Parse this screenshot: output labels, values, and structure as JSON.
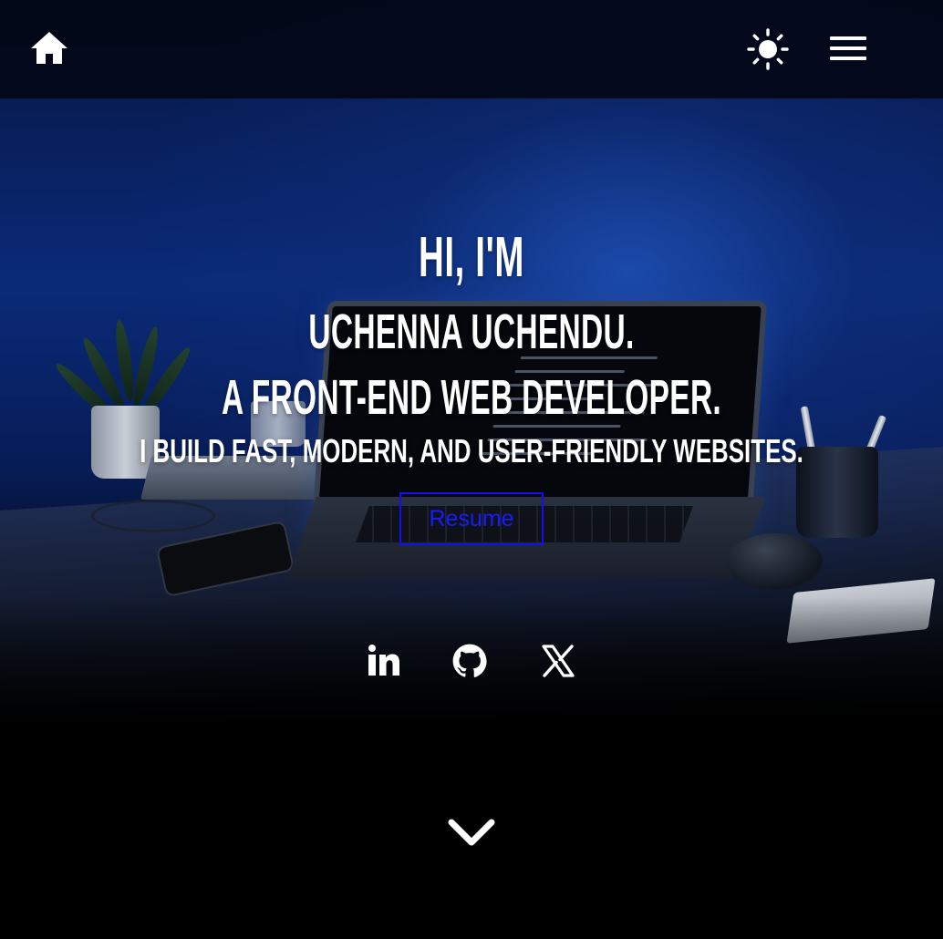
{
  "header": {
    "home_icon": "home-icon",
    "theme_icon": "sun-icon",
    "menu_icon": "hamburger-menu-icon"
  },
  "hero": {
    "greeting": "Hi, I'm",
    "name": "Uchenna Uchendu.",
    "role": "A Front-end Web developer.",
    "tagline": "I build fast, modern, and user-friendly websites.",
    "resume_label": "Resume"
  },
  "social": {
    "items": [
      {
        "icon": "linkedin-icon",
        "label": "LinkedIn"
      },
      {
        "icon": "github-icon",
        "label": "GitHub"
      },
      {
        "icon": "x-icon",
        "label": "X"
      }
    ]
  },
  "scroll": {
    "icon": "chevron-down-icon"
  },
  "colors": {
    "background": "#000000",
    "hero_blue": "#0a2a78",
    "resume_border": "#1111ee",
    "resume_text": "#1a1aff",
    "text": "#ffffff"
  }
}
